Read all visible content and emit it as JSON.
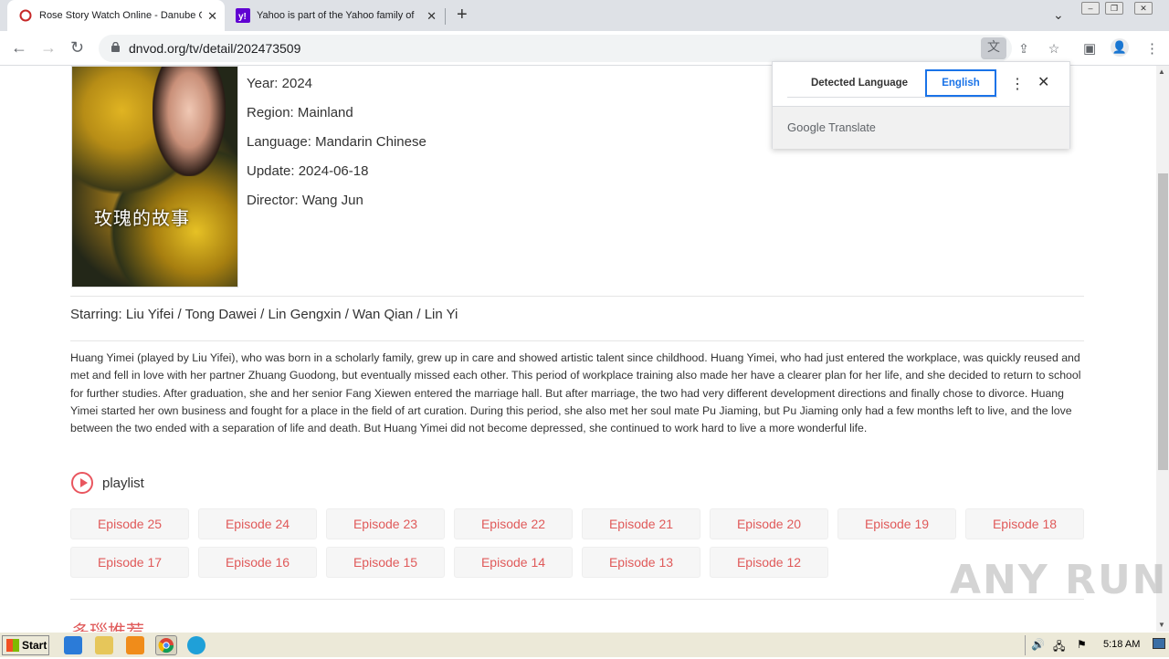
{
  "browser": {
    "tabs": [
      {
        "title": "Rose Story Watch Online - Danube C",
        "active": true
      },
      {
        "title": "Yahoo is part of the Yahoo family of",
        "active": false
      }
    ],
    "url": "dnvod.org/tv/detail/202473509"
  },
  "details": {
    "year": "Year: 2024",
    "region": "Region: Mainland",
    "language": "Language: Mandarin Chinese",
    "update": "Update: 2024-06-18",
    "director": "Director: Wang Jun",
    "starring": "Starring: Liu Yifei / Tong Dawei / Lin Gengxin / Wan Qian / Lin Yi",
    "poster_title": "玫瑰的故事"
  },
  "description": "Huang Yimei (played by Liu Yifei), who was born in a scholarly family, grew up in care and showed artistic talent since childhood. Huang Yimei, who had just entered the workplace, was quickly reused and met and fell in love with her partner Zhuang Guodong, but eventually missed each other. This period of workplace training also made her have a clearer plan for her life, and she decided to return to school for further studies. After graduation, she and her senior Fang Xiewen entered the marriage hall. But after marriage, the two had very different development directions and finally chose to divorce. Huang Yimei started her own business and fought for a place in the field of art curation. During this period, she also met her soul mate Pu Jiaming, but Pu Jiaming only had a few months left to live, and the love between the two ended with a separation of life and death. But Huang Yimei did not become depressed, she continued to work hard to live a more wonderful life.",
  "playlist": {
    "label": "playlist",
    "episodes": [
      "Episode 25",
      "Episode 24",
      "Episode 23",
      "Episode 22",
      "Episode 21",
      "Episode 20",
      "Episode 19",
      "Episode 18",
      "Episode 17",
      "Episode 16",
      "Episode 15",
      "Episode 14",
      "Episode 13",
      "Episode 12"
    ]
  },
  "recommend_title": "多瑙推荐",
  "translate": {
    "tab_detected": "Detected Language",
    "tab_english": "English",
    "brand": "Google",
    "brand_suffix": "Translate"
  },
  "watermark": "ANY RUN",
  "taskbar": {
    "start": "Start",
    "clock": "5:18 AM"
  },
  "colors": {
    "accent": "#e05a5a",
    "translate_blue": "#1a73e8"
  }
}
